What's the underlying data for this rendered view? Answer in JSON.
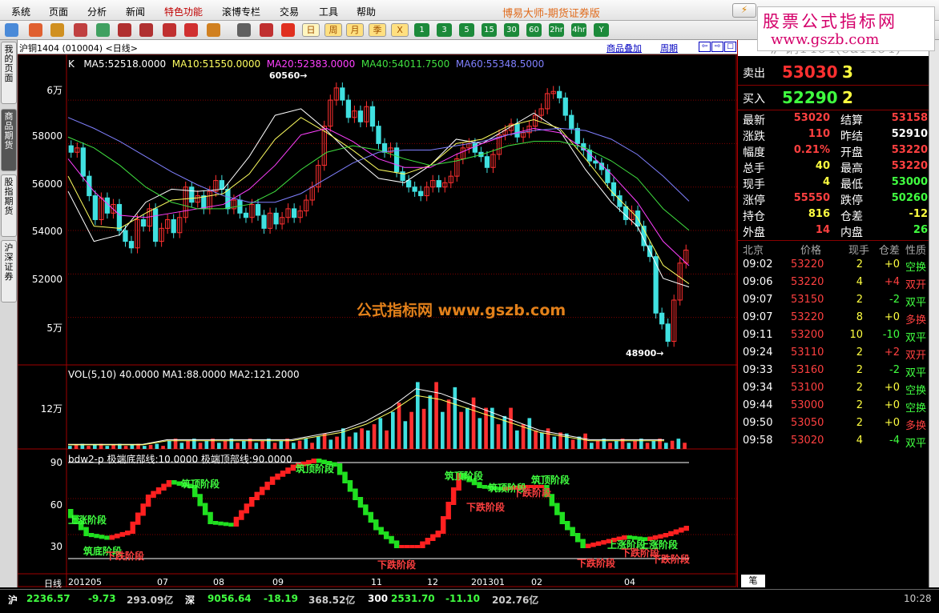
{
  "app": {
    "title": "博易大师-期货证券版"
  },
  "menu": [
    "系统",
    "页面",
    "分析",
    "新闻",
    "特色功能",
    "滚博专栏",
    "交易",
    "工具",
    "帮助"
  ],
  "promo": {
    "line1": "股票公式指标网",
    "line2": "www.gszb.com",
    "color": "#d4006a"
  },
  "toolbar": {
    "periods": [
      "日",
      "周",
      "月",
      "季",
      "X",
      "1",
      "3",
      "5",
      "15",
      "30",
      "60",
      "2hr",
      "4hr",
      "Y"
    ]
  },
  "left_tabs": [
    "我的页面",
    "商品期货",
    "股指期货",
    "沪深证券"
  ],
  "chart": {
    "instrument": "沪铜1404 (010004) <日线>",
    "links": [
      "商品叠加",
      "周期"
    ],
    "ma_legend": {
      "k": "K",
      "ma5": "MA5:52518.0000",
      "ma10": "MA10:51550.0000",
      "ma20": "MA20:52383.0000",
      "ma40": "MA40:54011.7500",
      "ma60": "MA60:55348.5000"
    },
    "vol_legend": "VOL(5,10)  40.0000  MA1:88.0000  MA2:121.2000",
    "bdw_legend": "bdw2-p  极端底部线:10.0000  极端顶部线:90.0000",
    "price_ticks": [
      "6万",
      "58000",
      "56000",
      "54000",
      "52000",
      "5万"
    ],
    "vol_ticks": [
      "12万"
    ],
    "bdw_ticks": [
      "90",
      "60",
      "30"
    ],
    "x_labels": [
      "日线",
      "201205",
      "07",
      "08",
      "09",
      "11",
      "12",
      "201301",
      "02",
      "04"
    ],
    "high_label": "60560",
    "low_label": "48900",
    "watermark": "公式指标网  www.gszb.com",
    "stage_labels": {
      "up": "上涨阶段",
      "down": "下跌阶段",
      "bottom": "筑底阶段",
      "top": "筑顶阶段"
    }
  },
  "chart_data": {
    "type": "line",
    "title": "",
    "series": [
      {
        "name": "K",
        "values": [
          57600,
          57800,
          56500,
          55600,
          54500,
          55500,
          54800,
          55200,
          54000,
          53500,
          53200,
          54500,
          54200,
          55000,
          53500,
          54100,
          54500,
          53900,
          54600,
          56000,
          55300,
          55600,
          55000,
          55800,
          56300,
          55900,
          55000,
          55400,
          54800,
          54600,
          55200,
          54700,
          54100,
          54800,
          54300,
          54600,
          55000,
          54600,
          54900,
          55400,
          56000,
          57000,
          58800,
          60000,
          60560,
          60000,
          59200,
          59500,
          59000,
          59700,
          58800,
          58000,
          57600,
          57800,
          56700,
          56300,
          56000,
          55800,
          55600,
          56000,
          56300,
          56000,
          56200,
          56500,
          57300,
          57800,
          58000,
          57600,
          57400,
          56900,
          57500,
          58400,
          58600,
          58900,
          58300,
          58500,
          58800,
          59300,
          59600,
          60300,
          60400,
          60100,
          59300,
          58700,
          58000,
          57700,
          57200,
          57100,
          56800,
          56200,
          55600,
          55100,
          54500,
          54900,
          54200,
          53300,
          52800,
          50200,
          49700,
          48900,
          50800,
          52500,
          53100
        ]
      },
      {
        "name": "MA5",
        "values": [
          55800,
          53500,
          53800,
          55300,
          55900,
          55800,
          55900,
          57400,
          59300,
          59600,
          58600,
          57400,
          56400,
          56200,
          57000,
          58200,
          58000,
          58700,
          59400,
          58600,
          56800,
          55300,
          54200,
          51800,
          51400
        ]
      },
      {
        "name": "MA10",
        "values": [
          56500,
          54200,
          54100,
          54800,
          55400,
          55500,
          55700,
          56600,
          58200,
          59200,
          58500,
          57700,
          56800,
          56600,
          57000,
          58000,
          58200,
          58800,
          59100,
          58700,
          57300,
          55800,
          54600,
          52400,
          51550
        ]
      },
      {
        "name": "MA20",
        "values": [
          57300,
          55800,
          54700,
          54600,
          54800,
          55000,
          55200,
          55900,
          57000,
          58400,
          58700,
          58100,
          57300,
          56900,
          56900,
          57500,
          58000,
          58400,
          58700,
          58500,
          57700,
          56600,
          55300,
          53500,
          52383
        ]
      },
      {
        "name": "MA40",
        "values": [
          58300,
          57800,
          57000,
          56000,
          55300,
          55000,
          55000,
          55200,
          55800,
          56800,
          57600,
          57900,
          57700,
          57300,
          57000,
          57200,
          57500,
          57900,
          58100,
          58100,
          57800,
          57200,
          56400,
          55000,
          54012
        ]
      },
      {
        "name": "MA60",
        "values": [
          59200,
          58700,
          58100,
          57400,
          56700,
          56100,
          55600,
          55300,
          55300,
          55700,
          56400,
          57100,
          57600,
          57700,
          57700,
          57900,
          58100,
          58400,
          58600,
          58700,
          58600,
          58200,
          57500,
          56500,
          55349
        ]
      },
      {
        "name": "VOL",
        "values": [
          1,
          1,
          1,
          1,
          2,
          2,
          2,
          2,
          2,
          2,
          3,
          4,
          6,
          9,
          13,
          12,
          10,
          8,
          6,
          4,
          3,
          2,
          2,
          2,
          2
        ]
      },
      {
        "name": "bdw2-p",
        "values": [
          50,
          30,
          27,
          32,
          62,
          74,
          70,
          40,
          38,
          60,
          77,
          87,
          92,
          88,
          60,
          35,
          20,
          20,
          32,
          80,
          70,
          68,
          70,
          70,
          40,
          20,
          24,
          28,
          26,
          30,
          36
        ]
      }
    ],
    "ylim": [
      48000,
      62000
    ],
    "xlabel": "",
    "ylabel": ""
  },
  "quote": {
    "title": "沪铜1404(cu1404)",
    "ask": {
      "label": "卖出",
      "price": "53030",
      "vol": "3"
    },
    "bid": {
      "label": "买入",
      "price": "52290",
      "vol": "2"
    },
    "rows": [
      [
        "最新",
        "53020",
        "结算",
        "53158"
      ],
      [
        "涨跌",
        "110",
        "昨结",
        "52910"
      ],
      [
        "幅度",
        "0.21%",
        "开盘",
        "53220"
      ],
      [
        "总手",
        "40",
        "最高",
        "53220"
      ],
      [
        "现手",
        "4",
        "最低",
        "53000"
      ],
      [
        "涨停",
        "55550",
        "跌停",
        "50260"
      ],
      [
        "持仓",
        "816",
        "仓差",
        "-12"
      ],
      [
        "外盘",
        "14",
        "内盘",
        "26"
      ]
    ],
    "tick_header": [
      "北京",
      "价格",
      "现手",
      "仓差",
      "性质"
    ],
    "ticks": [
      [
        "09:02",
        "53220",
        "2",
        "+0",
        "空换"
      ],
      [
        "09:06",
        "53220",
        "4",
        "+4",
        "双开"
      ],
      [
        "09:07",
        "53150",
        "2",
        "-2",
        "双平"
      ],
      [
        "09:07",
        "53220",
        "8",
        "+0",
        "多换"
      ],
      [
        "09:11",
        "53200",
        "10",
        "-10",
        "双平"
      ],
      [
        "09:24",
        "53110",
        "2",
        "+2",
        "双开"
      ],
      [
        "09:33",
        "53160",
        "2",
        "-2",
        "双平"
      ],
      [
        "09:34",
        "53100",
        "2",
        "+0",
        "空换"
      ],
      [
        "09:44",
        "53000",
        "2",
        "+0",
        "空换"
      ],
      [
        "09:50",
        "53050",
        "2",
        "+0",
        "多换"
      ],
      [
        "09:58",
        "53020",
        "4",
        "-4",
        "双平"
      ]
    ],
    "bottom_tab": "笔"
  },
  "status": {
    "sh": {
      "label": "沪",
      "val": "2236.57",
      "chg": "-9.73",
      "amt": "293.09亿"
    },
    "sz": {
      "label": "深",
      "val": "9056.64",
      "chg": "-18.19",
      "amt": "368.52亿"
    },
    "c300": {
      "label": "300",
      "val": "2531.70",
      "chg": "-11.10",
      "amt": "202.76亿"
    },
    "time": "10:28"
  }
}
